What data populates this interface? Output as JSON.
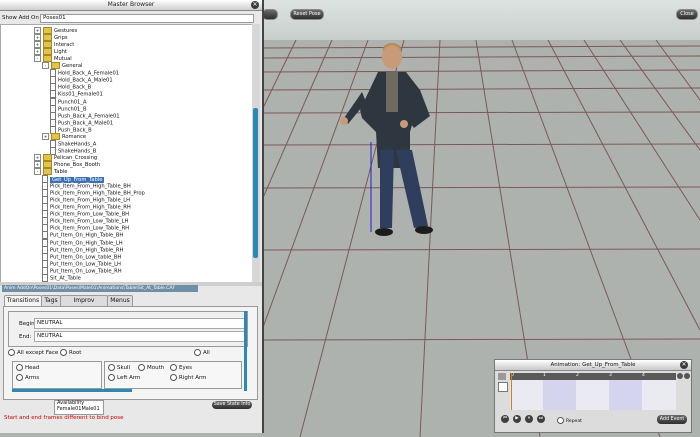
{
  "toolbar": {
    "button1": "",
    "button2": "Reset Pose",
    "button3": "Close"
  },
  "master_browser": {
    "title": "Master Browser",
    "close": "✕",
    "show_label": "Show Add On",
    "show_value": "Poses01"
  },
  "tree": [
    {
      "label": "Gestures",
      "type": "folder",
      "indent": 0,
      "expand": "+"
    },
    {
      "label": "Grips",
      "type": "folder",
      "indent": 0,
      "expand": "+"
    },
    {
      "label": "Interact",
      "type": "folder",
      "indent": 0,
      "expand": "+"
    },
    {
      "label": "Light",
      "type": "folder",
      "indent": 0,
      "expand": "+"
    },
    {
      "label": "Mutual",
      "type": "folder",
      "indent": 0,
      "expand": "-"
    },
    {
      "label": "General",
      "type": "folder",
      "indent": 1,
      "expand": "-"
    },
    {
      "label": "Hold_Back_A_Female01",
      "type": "item",
      "indent": 2
    },
    {
      "label": "Hold_Back_A_Male01",
      "type": "item",
      "indent": 2
    },
    {
      "label": "Hold_Back_B",
      "type": "item",
      "indent": 2
    },
    {
      "label": "Kiss01_Female01",
      "type": "item",
      "indent": 2
    },
    {
      "label": "Punch01_A",
      "type": "item",
      "indent": 2
    },
    {
      "label": "Punch01_B",
      "type": "item",
      "indent": 2
    },
    {
      "label": "Push_Back_A_Female01",
      "type": "item",
      "indent": 2
    },
    {
      "label": "Push_Back_A_Male01",
      "type": "item",
      "indent": 2
    },
    {
      "label": "Push_Back_B",
      "type": "item",
      "indent": 2
    },
    {
      "label": "Romance",
      "type": "folder",
      "indent": 1,
      "expand": "+"
    },
    {
      "label": "ShakeHands_A",
      "type": "item",
      "indent": 2
    },
    {
      "label": "ShakeHands_B",
      "type": "item",
      "indent": 2
    },
    {
      "label": "Pelican_Crossing",
      "type": "folder",
      "indent": 0,
      "expand": "+"
    },
    {
      "label": "Phone_Box_Booth",
      "type": "folder",
      "indent": 0,
      "expand": "+"
    },
    {
      "label": "Table",
      "type": "folder",
      "indent": 0,
      "expand": "-"
    },
    {
      "label": "Get_Up_From_Table",
      "type": "item",
      "indent": 1,
      "selected": true
    },
    {
      "label": "Pick_Item_From_High_Table_BH",
      "type": "item",
      "indent": 1
    },
    {
      "label": "Pick_Item_From_High_Table_BH_Prop",
      "type": "item",
      "indent": 1
    },
    {
      "label": "Pick_Item_From_High_Table_LH",
      "type": "item",
      "indent": 1
    },
    {
      "label": "Pick_Item_From_High_Table_RH",
      "type": "item",
      "indent": 1
    },
    {
      "label": "Pick_Item_From_Low_Table_BH",
      "type": "item",
      "indent": 1
    },
    {
      "label": "Pick_Item_From_Low_Table_LH",
      "type": "item",
      "indent": 1
    },
    {
      "label": "Pick_Item_From_Low_Table_RH",
      "type": "item",
      "indent": 1
    },
    {
      "label": "Put_Item_On_High_Table_BH",
      "type": "item",
      "indent": 1
    },
    {
      "label": "Put_Item_On_High_Table_LH",
      "type": "item",
      "indent": 1
    },
    {
      "label": "Put_Item_On_High_Table_RH",
      "type": "item",
      "indent": 1
    },
    {
      "label": "Put_Item_On_Low_table_BH",
      "type": "item",
      "indent": 1
    },
    {
      "label": "Put_Item_On_Low_Table_LH",
      "type": "item",
      "indent": 1
    },
    {
      "label": "Put_Item_On_Low_Table_RH",
      "type": "item",
      "indent": 1
    },
    {
      "label": "Sit_At_Table",
      "type": "item",
      "indent": 1
    }
  ],
  "path_bar": "Anim  AddOn\\Poses01\\Data\\Poses\\Male01\\Animations\\Table\\Sit_At_Table.CAF",
  "tabs": [
    "Transitions",
    "Tags",
    "Improv Weights",
    "Menus"
  ],
  "transitions": {
    "begin_label": "Begin:",
    "begin_value": "NEUTRAL",
    "end_label": "End:",
    "end_value": "NEUTRAL",
    "options_top": [
      "All except Face",
      "Root",
      "All"
    ],
    "options_left": [
      "Head",
      "Arms"
    ],
    "options_right": [
      "Skull",
      "Mouth",
      "Eyes",
      "Left Arm",
      "Right Arm"
    ]
  },
  "availability": {
    "label": "Availability",
    "value": "Female01Male01"
  },
  "save_button": "Save State Info",
  "warning": "Start and end frames different to bind pose",
  "animation_panel": {
    "title": "Animation: Get_Up_From_Table",
    "close": "✕",
    "ticks": [
      "0",
      "1",
      "2",
      "3",
      "4"
    ],
    "repeat_label": "Repeat",
    "add_event": "Add Event"
  }
}
